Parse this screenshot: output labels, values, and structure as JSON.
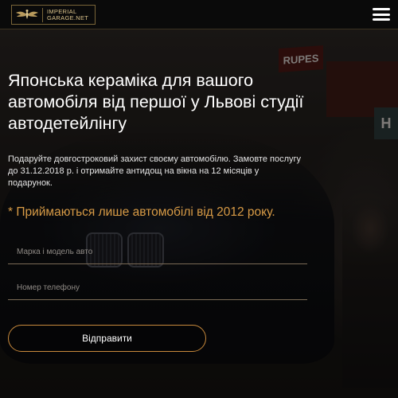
{
  "header": {
    "logo_line1": "IMPERIAL",
    "logo_line2": "GARAGE.NET",
    "logo_icon": "winged-emblem-icon",
    "menu_icon": "hamburger-menu-icon"
  },
  "background": {
    "sign_text": "RUPES",
    "sign_letter": "H"
  },
  "hero": {
    "title": "Японська кераміка для вашого автомобіля від першої у Львові студії автодетейлінгу",
    "description": "Подаруйте довгостроковий захист своєму автомобілю. Замовте послугу до 31.12.2018 р. і отримайте антидощ на вікна на 12 місяців у подарунок.",
    "notice": "* Приймаються лише автомобілі від 2012 року."
  },
  "form": {
    "car_placeholder": "Марка і модель авто",
    "phone_placeholder": "Номер телефону",
    "submit_label": "Відправити"
  },
  "colors": {
    "accent": "#d89b46",
    "button_border": "#c98a3c",
    "logo_gold": "#d9c28a",
    "header_bg": "#0a0a0a"
  }
}
